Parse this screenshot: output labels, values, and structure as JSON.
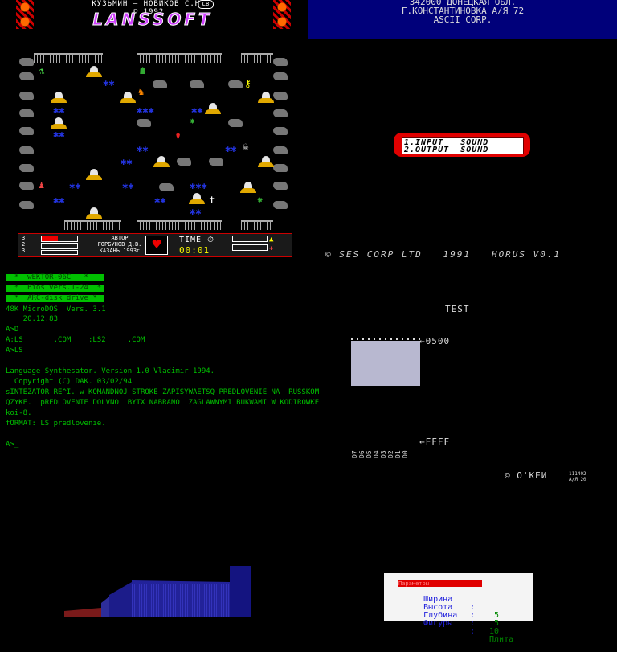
{
  "lanssoft": {
    "credit_line1": "КУЗЬМИН — НОВИКОВ С.Н.",
    "credit_line2": "© 1992",
    "badge": "CB",
    "title": "LANSSOFT",
    "status": {
      "author_label": "АВТОР",
      "author_name": "ГОРБУНОВ Д.В.",
      "author_city": "КАЗАНЬ 1993г",
      "time_label": "TIME",
      "time_value": "00:01",
      "counters": [
        "3",
        "2",
        "3"
      ]
    }
  },
  "address": {
    "line1": "342000 ДОНЕЦКАЯ ОБЛ.",
    "line2": "Г.КОНСТАНТИНОВКА А/Я 72",
    "line3": "ASCII CORP."
  },
  "sound_menu": {
    "item1": "1.INPUT   SOUND",
    "item2": "2.OUTPUT  SOUND",
    "copyright": "© SES CORP LTD   1991   HORUS V0.1"
  },
  "terminal": {
    "bars": [
      "  *  wEKTOR-06C   *",
      "  *  Bios vers.1-24  *",
      "  *  ARC-disk drive *"
    ],
    "lines": [
      "48K MicroDOS  Vers. 3.1",
      "    20.12.83",
      "A>D",
      "A:LS       .COM    :LS2     .COM",
      "A>LS",
      "",
      "Language Synthesator. Version 1.0 Vladimir 1994.",
      "  Copyright (C) DAK. 03/02/94",
      "sINTEZATOR RE^I. w KOMANDNOJ STROKE ZAPISYWAETSQ PREDLOVENIE NA  RUSSKOM",
      "QZYKE.  pREDLOVENIE DOLVNO  BYTX NABRANO  ZAGLAWNYMI BUKWAMI W KODIROWKE",
      "koi-8.",
      "fORMAT: LS predlovenie.",
      "",
      "A>_"
    ]
  },
  "memtest": {
    "title": "TEST",
    "addr_top": "←0500",
    "addr_bottom": "←FFFF",
    "bits": [
      "D7",
      "D6",
      "D5",
      "D4",
      "D3",
      "D2",
      "D1",
      "D0"
    ],
    "brand": "© О'КЕИ",
    "serial": "111402\nA/Я 20"
  },
  "dialog": {
    "title": "Параметры",
    "rows": [
      {
        "label": "Ширина",
        "value": "5"
      },
      {
        "label": "Высота",
        "value": "5"
      },
      {
        "label": "Глубина",
        "value": "10"
      },
      {
        "label": "Фигуры",
        "value": "Плита"
      }
    ]
  },
  "colors": {
    "banner_bg": "#00007a",
    "terminal_green": "#00c000",
    "menu_red": "#e00000",
    "title_magenta": "#d040ff"
  }
}
